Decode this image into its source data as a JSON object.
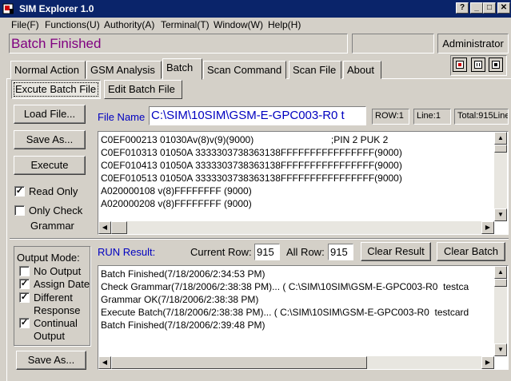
{
  "window": {
    "title": "SIM Explorer 1.0",
    "help_glyph": "?",
    "minimize_glyph": "_",
    "maximize_glyph": "□",
    "close_glyph": "✕"
  },
  "menu": [
    "File(F)",
    "Functions(U)",
    "Authority(A)",
    "Terminal(T)",
    "Window(W)",
    "Help(H)"
  ],
  "status": {
    "message": "Batch Finished",
    "user": "Administrator"
  },
  "tabs": [
    "Normal Action",
    "GSM Analysis",
    "Batch",
    "Scan Command",
    "Scan File",
    "About"
  ],
  "active_tab": "Batch",
  "subtabs": [
    "Excute Batch File",
    "Edit Batch File"
  ],
  "batch": {
    "load_file": "Load File...",
    "save_as": "Save As...",
    "execute": "Execute",
    "read_only": {
      "label": "Read Only",
      "checked": true
    },
    "only_check": {
      "label_1": "Only Check",
      "label_2": "Grammar",
      "checked": false
    },
    "file_name_label": "File Name",
    "file_name_value": "C:\\SIM\\10SIM\\GSM-E-GPC003-R0  t",
    "row": "ROW:1",
    "line": "Line:1",
    "total": "Total:915Line",
    "script_lines": [
      "C0EF000213 01030Av(8)v(9)(9000)                             ;PIN 2 PUK 2",
      "C0EF010313 01050A 3333303738363138FFFFFFFFFFFFFFFF(9000)",
      "C0EF010413 01050A 3333303738363138FFFFFFFFFFFFFFFF(9000)",
      "C0EF010513 01050A 3333303738363138FFFFFFFFFFFFFFFF(9000)",
      "A020000108 v(8)FFFFFFFF (9000)",
      "A020000208 v(8)FFFFFFFF (9000)"
    ]
  },
  "output": {
    "mode_label": "Output Mode:",
    "no_output": {
      "label": "No Output",
      "checked": false
    },
    "assign_date": {
      "label": "Assign Date",
      "checked": true
    },
    "different_response": {
      "label_1": "Different",
      "label_2": "Response",
      "checked": true
    },
    "continual_output": {
      "label_1": "Continual",
      "label_2": "Output",
      "checked": true
    },
    "save_as": "Save As..."
  },
  "run": {
    "label": "RUN Result:",
    "current_row_label": "Current Row:",
    "current_row": "915",
    "all_row_label": "All Row:",
    "all_row": "915",
    "clear_result": "Clear Result",
    "clear_batch": "Clear Batch",
    "result_lines": [
      "Batch Finished(7/18/2006/2:34:53 PM)",
      "Check Grammar(7/18/2006/2:38:38 PM)... ( C:\\SIM\\10SIM\\GSM-E-GPC003-R0  testca",
      "Grammar OK(7/18/2006/2:38:38 PM)",
      "Execute Batch(7/18/2006/2:38:38 PM)... ( C:\\SIM\\10SIM\\GSM-E-GPC003-R0  testcard",
      "Batch Finished(7/18/2006/2:39:48 PM)"
    ]
  },
  "icons": {
    "app": "sim-explorer-app-icon",
    "record": "record-icon",
    "pause": "pause-icon",
    "stop": "stop-icon"
  },
  "colors": {
    "title_bar": "#0a246a",
    "status_text": "#800080",
    "label_blue": "#0000c0",
    "record_red": "#cc0000",
    "face": "#d4d0c8"
  }
}
